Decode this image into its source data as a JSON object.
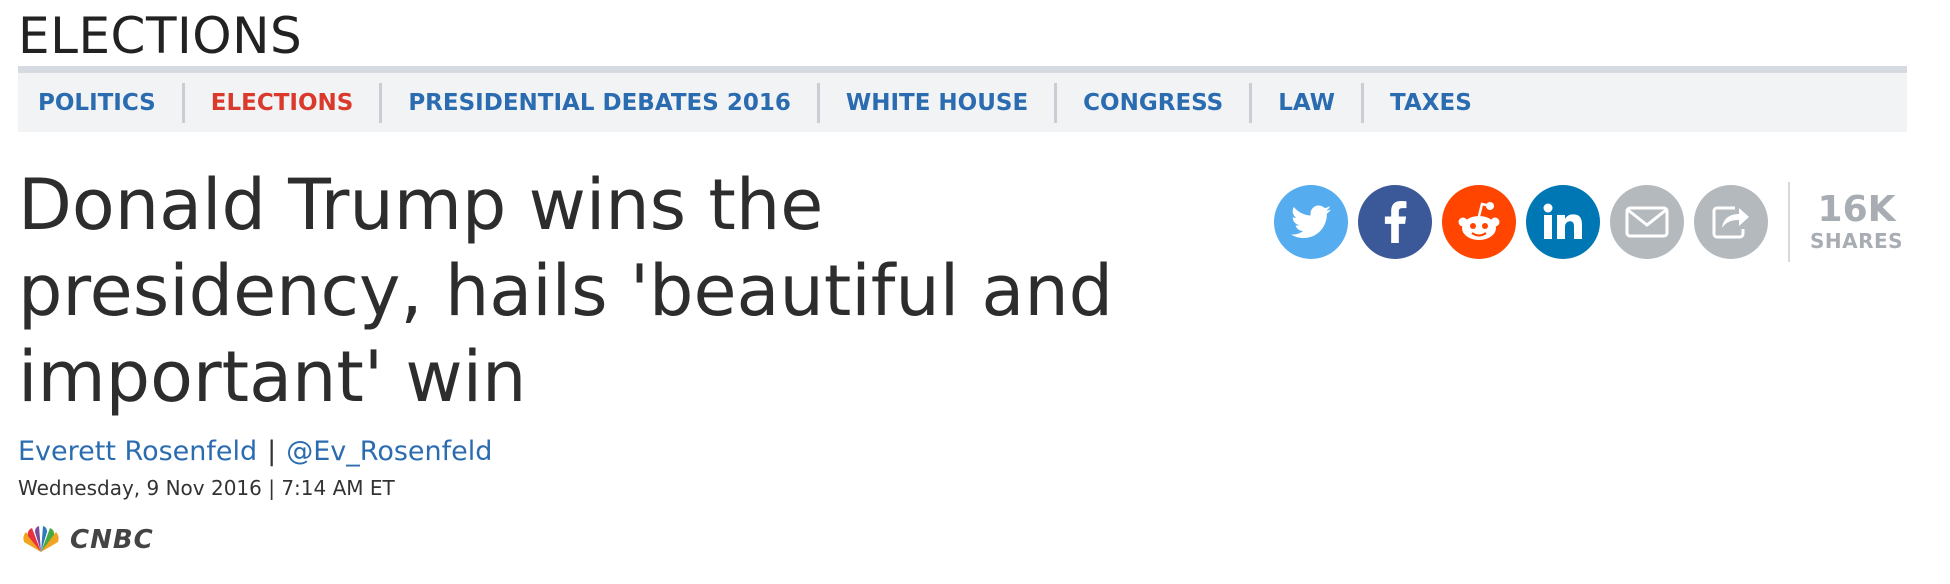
{
  "section": {
    "title": "ELECTIONS"
  },
  "nav": {
    "items": [
      {
        "label": "POLITICS"
      },
      {
        "label": "ELECTIONS"
      },
      {
        "label": "PRESIDENTIAL DEBATES 2016"
      },
      {
        "label": "WHITE HOUSE"
      },
      {
        "label": "CONGRESS"
      },
      {
        "label": "LAW"
      },
      {
        "label": "TAXES"
      }
    ],
    "active_index": 1
  },
  "article": {
    "headline": "Donald Trump wins the presidency, hails 'beautiful and important' win",
    "author": "Everett Rosenfeld",
    "separator": "|",
    "twitter_handle": "@Ev_Rosenfeld",
    "dateline": "Wednesday, 9 Nov 2016 | 7:14 AM ET"
  },
  "brand": {
    "name": "CNBC"
  },
  "share": {
    "buttons": [
      {
        "icon": "twitter-icon",
        "color": "#55acee"
      },
      {
        "icon": "facebook-icon",
        "color": "#3b5998"
      },
      {
        "icon": "reddit-icon",
        "color": "#ff4500"
      },
      {
        "icon": "linkedin-icon",
        "color": "#0077b5"
      },
      {
        "icon": "email-icon",
        "color": "#b4b9be"
      },
      {
        "icon": "share-icon",
        "color": "#b4b9be"
      }
    ],
    "count": "16K",
    "count_label": "SHARES"
  },
  "colors": {
    "link": "#2b6cb0",
    "active_nav": "#d93a2b",
    "nav_bg": "#f2f3f5"
  }
}
